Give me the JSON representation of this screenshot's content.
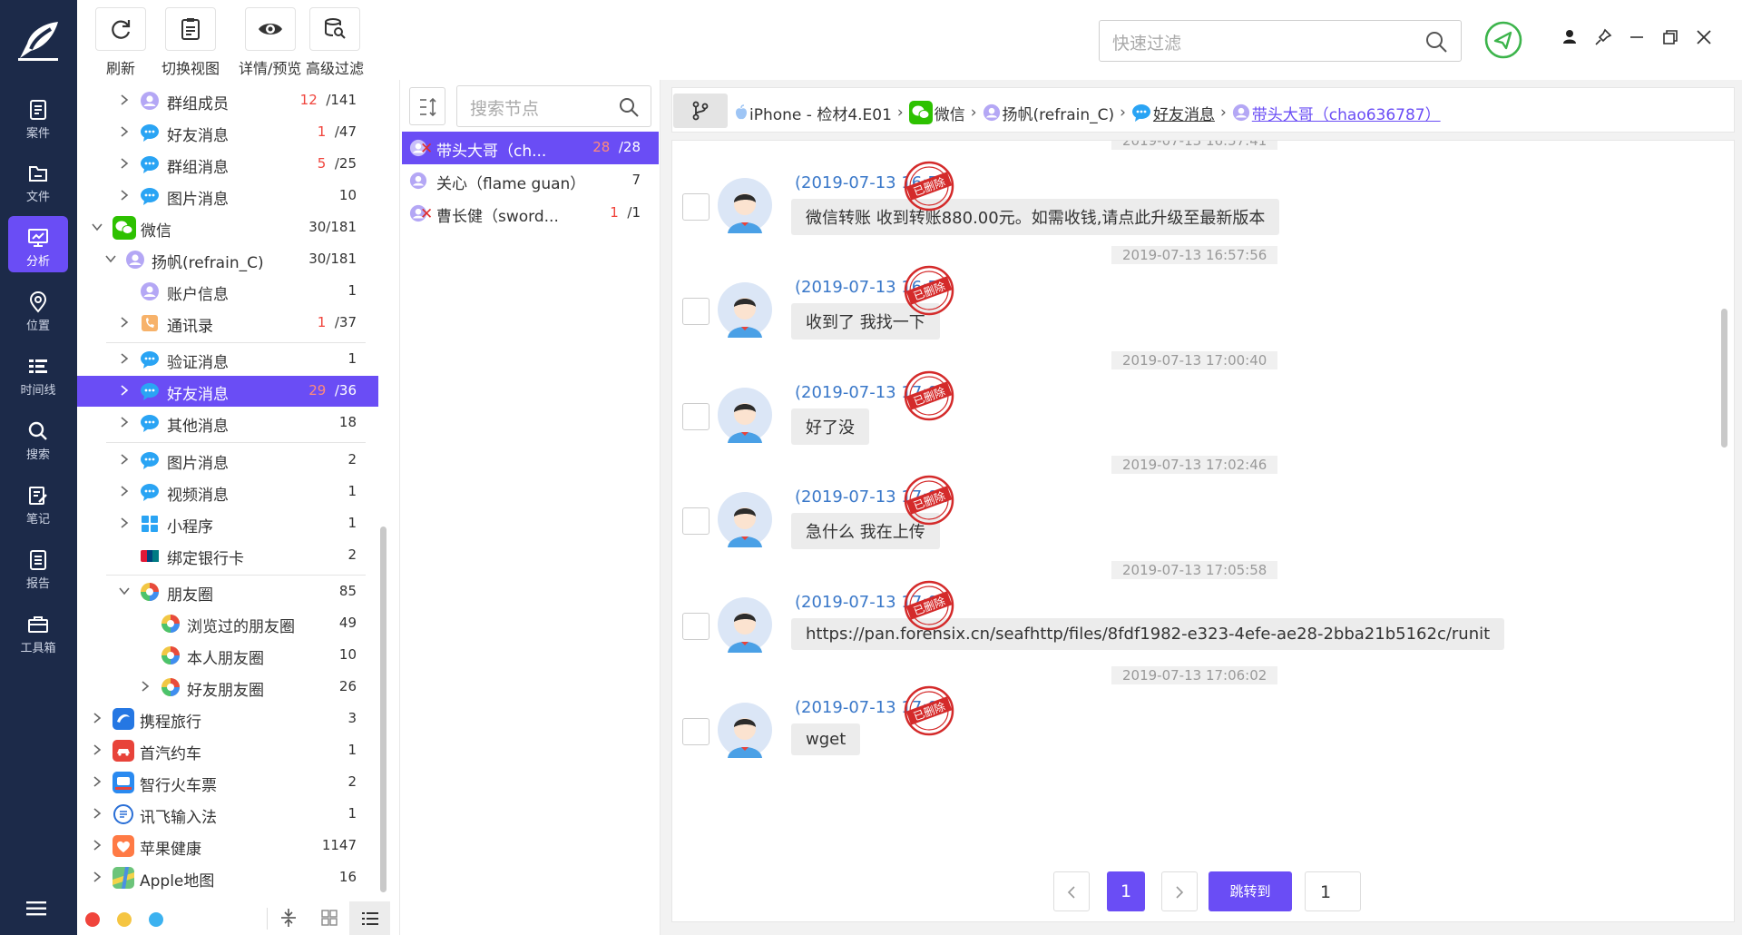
{
  "toolbar": {
    "refresh": "刷新",
    "switch_view": "切换视图",
    "detail_preview": "详情/预览",
    "advanced_filter": "高级过滤",
    "quick_filter_placeholder": "快速过滤"
  },
  "rail": [
    {
      "label": "案件",
      "icon": "case-icon"
    },
    {
      "label": "文件",
      "icon": "folder-icon"
    },
    {
      "label": "分析",
      "icon": "analysis-icon",
      "active": true
    },
    {
      "label": "位置",
      "icon": "location-icon"
    },
    {
      "label": "时间线",
      "icon": "timeline-icon"
    },
    {
      "label": "搜索",
      "icon": "search-icon"
    },
    {
      "label": "笔记",
      "icon": "note-icon"
    },
    {
      "label": "报告",
      "icon": "report-icon"
    },
    {
      "label": "工具箱",
      "icon": "toolbox-icon"
    }
  ],
  "tree": {
    "r0": {
      "label": "群组成员",
      "del": "12",
      "total": "/141"
    },
    "r1": {
      "label": "好友消息",
      "del": "1",
      "total": "/47"
    },
    "r2": {
      "label": "群组消息",
      "del": "5",
      "total": "/25"
    },
    "r3": {
      "label": "图片消息",
      "total": "10"
    },
    "r4": {
      "label": "微信",
      "total": "30/181"
    },
    "r5": {
      "label": "扬帆(refrain_C)",
      "total": "30/181"
    },
    "r6": {
      "label": "账户信息",
      "total": "1"
    },
    "r7": {
      "label": "通讯录",
      "del": "1",
      "total": "/37"
    },
    "r8": {
      "label": "验证消息",
      "total": "1"
    },
    "r9": {
      "label": "好友消息",
      "del": "29",
      "total": "/36"
    },
    "r10": {
      "label": "其他消息",
      "total": "18"
    },
    "r11": {
      "label": "图片消息",
      "total": "2"
    },
    "r12": {
      "label": "视频消息",
      "total": "1"
    },
    "r13": {
      "label": "小程序",
      "total": "1"
    },
    "r14": {
      "label": "绑定银行卡",
      "total": "2"
    },
    "r15": {
      "label": "朋友圈",
      "total": "85"
    },
    "r16": {
      "label": "浏览过的朋友圈",
      "total": "49"
    },
    "r17": {
      "label": "本人朋友圈",
      "total": "10"
    },
    "r18": {
      "label": "好友朋友圈",
      "total": "26"
    },
    "r19": {
      "label": "携程旅行",
      "total": "3"
    },
    "r20": {
      "label": "首汽约车",
      "total": "1"
    },
    "r21": {
      "label": "智行火车票",
      "total": "2"
    },
    "r22": {
      "label": "讯飞输入法",
      "total": "1"
    },
    "r23": {
      "label": "苹果健康",
      "total": "1147"
    },
    "r24": {
      "label": "Apple地图",
      "total": "16"
    }
  },
  "contacts": {
    "search_placeholder": "搜索节点",
    "c0": {
      "name": "带头大哥（ch...",
      "del": "28",
      "total": "/28"
    },
    "c1": {
      "name": "关心（flame guan）",
      "total": "7"
    },
    "c2": {
      "name": "曹长健（sword...",
      "del": "1",
      "total": "/1"
    }
  },
  "breadcrumb": {
    "device": "iPhone - 检材4.E01",
    "app": "微信",
    "account": "扬帆(refrain_C)",
    "category": "好友消息",
    "contact": "带头大哥（chao636787）"
  },
  "chat": {
    "stamp_text": "已删除",
    "top_partial_time": "2019-07-13 16:57:41",
    "m0": {
      "sender": "(2019-07-13 16:57",
      "text": "微信转账 收到转账880.00元。如需收钱,请点此升级至最新版本"
    },
    "t1": "2019-07-13 16:57:56",
    "m1": {
      "sender": "(2019-07-13 16:57",
      "text": "收到了 我找一下"
    },
    "t2": "2019-07-13 17:00:40",
    "m2": {
      "sender": "(2019-07-13 17:00",
      "text": "好了没"
    },
    "t3": "2019-07-13 17:02:46",
    "m3": {
      "sender": "(2019-07-13 17:02",
      "text": "急什么 我在上传"
    },
    "t4": "2019-07-13 17:05:58",
    "m4": {
      "sender": "(2019-07-13 17:05",
      "text": "https://pan.forensix.cn/seafhttp/files/8fdf1982-e323-4efe-ae28-2bba21b5162c/runit"
    },
    "t5": "2019-07-13 17:06:02",
    "m5": {
      "sender": "(2019-07-13 17:06",
      "text": "wget"
    }
  },
  "pagination": {
    "current": "1",
    "jump_label": "跳转到",
    "jump_value": "1"
  },
  "colors": {
    "accent": "#6a4df5",
    "rail_bg": "#1c2a49",
    "deleted_red": "#f0443c",
    "link_blue": "#3a78c9"
  }
}
